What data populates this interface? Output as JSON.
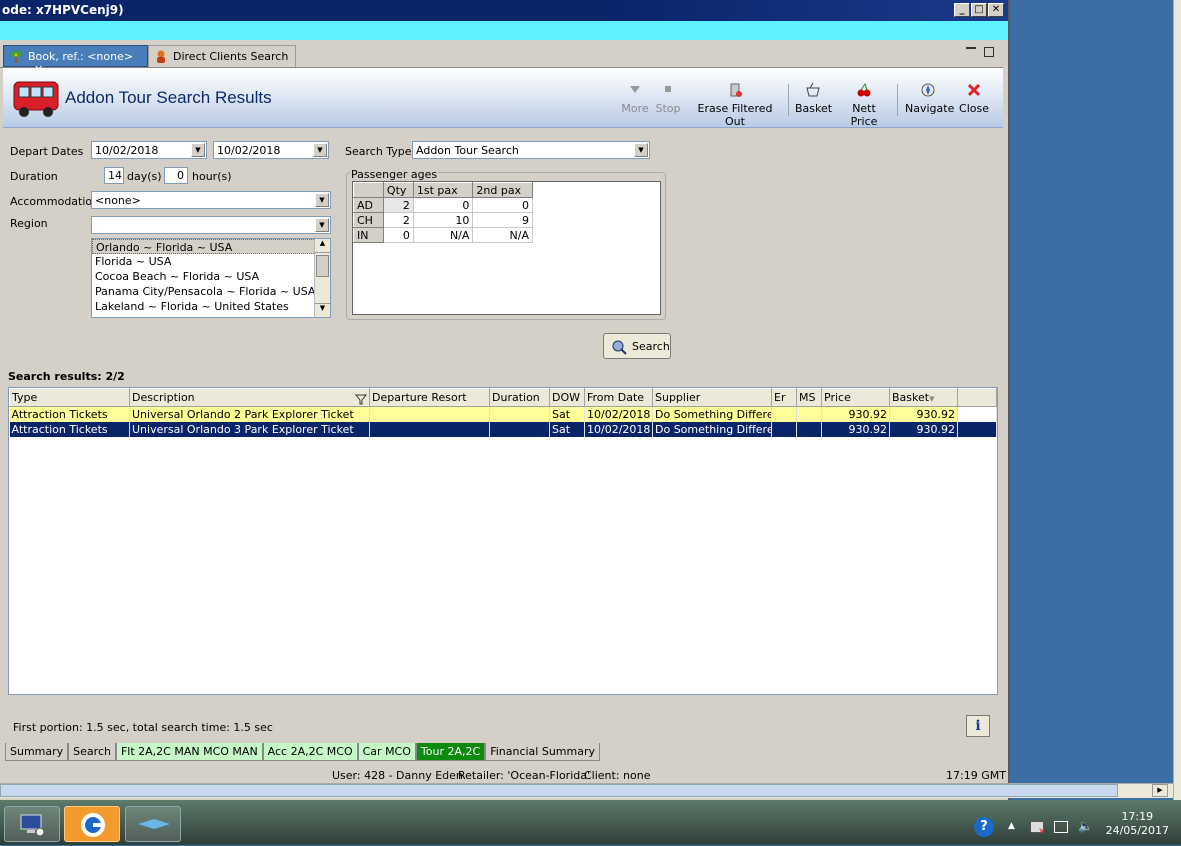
{
  "window": {
    "title": "ode: x7HPVCenj9)",
    "controls": {
      "minimize": "_",
      "maximize": "□",
      "close": "✕"
    }
  },
  "tabs": [
    {
      "label": "Book, ref.: <none>",
      "close": "✕"
    },
    {
      "label": "Direct Clients Search"
    }
  ],
  "header": {
    "title": "Addon Tour Search Results",
    "toolbar": {
      "more": "More",
      "stop": "Stop",
      "erase": "Erase Filtered Out",
      "basket": "Basket",
      "nett_price": "Nett Price",
      "navigate": "Navigate",
      "close": "Close"
    }
  },
  "form": {
    "depart_dates_label": "Depart Dates",
    "depart_from": "10/02/2018",
    "depart_to": "10/02/2018",
    "duration_label": "Duration",
    "duration_days": "14",
    "days_unit": "day(s)",
    "duration_hours": "0",
    "hours_unit": "hour(s)",
    "accommodation_label": "Accommodation",
    "accommodation_value": "<none>",
    "region_label": "Region",
    "region_value": "",
    "region_list": [
      "Orlando ~ Florida ~ USA",
      "Florida ~ USA",
      "Cocoa Beach ~ Florida ~ USA",
      "Panama City/Pensacola ~  Florida  ~ USA",
      "Lakeland ~ Florida ~ United States"
    ],
    "search_type_label": "Search Type",
    "search_type_value": "Addon Tour Search",
    "passenger_ages_label": "Passenger ages",
    "pax_headers": [
      "",
      "Qty",
      "1st pax",
      "2nd pax"
    ],
    "pax_rows": [
      [
        "AD",
        "2",
        "0",
        "0"
      ],
      [
        "CH",
        "2",
        "10",
        "9"
      ],
      [
        "IN",
        "0",
        "N/A",
        "N/A"
      ]
    ],
    "search_button": "Search"
  },
  "results": {
    "label": "Search results: 2/2",
    "columns": [
      "Type",
      "Description",
      "Departure Resort",
      "Duration",
      "DOW",
      "From Date",
      "Supplier",
      "Er",
      "MS",
      "Price",
      "Basket"
    ],
    "rows": [
      [
        "Attraction Tickets",
        "Universal Orlando 2 Park Explorer Ticket",
        "",
        "",
        "Sat",
        "10/02/2018",
        "Do Something Different",
        "",
        "",
        "930.92",
        "930.92"
      ],
      [
        "Attraction Tickets",
        "Universal Orlando 3 Park Explorer Ticket",
        "",
        "",
        "Sat",
        "10/02/2018",
        "Do Something Different",
        "",
        "",
        "930.92",
        "930.92"
      ]
    ]
  },
  "status": {
    "timing": "First portion: 1.5 sec, total search time: 1.5 sec",
    "info": "i",
    "user": "User: 428 - Danny Eden",
    "retailer": "Retailer: 'Ocean-Florida'",
    "client": "Client: none",
    "time": "17:19 GMT"
  },
  "bottom_tabs": [
    {
      "label": "Summary",
      "style": "plain"
    },
    {
      "label": "Search",
      "style": "plain"
    },
    {
      "label": "Flt 2A,2C MAN MCO MAN",
      "style": "light-green"
    },
    {
      "label": "Acc 2A,2C MCO",
      "style": "light-green"
    },
    {
      "label": "Car MCO",
      "style": "light-green"
    },
    {
      "label": "Tour 2A,2C",
      "style": "dark-green"
    },
    {
      "label": "Financial Summary",
      "style": "plain"
    }
  ],
  "taskbar": {
    "clock_time": "17:19",
    "clock_date": "24/05/2017"
  },
  "colors": {
    "title_bar": "#0a246a",
    "highlight_yellow": "#ffff99",
    "selected_row": "#0a246a",
    "cyan_bar": "#5ef2fe",
    "tab_active": "#0c8a0c"
  }
}
